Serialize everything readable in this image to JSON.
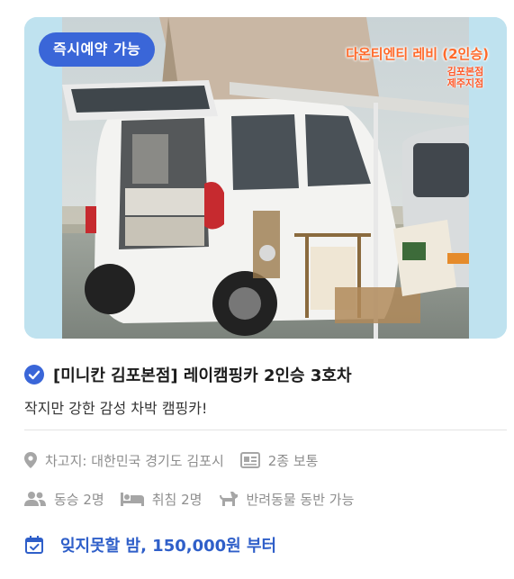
{
  "card": {
    "badge": "즉시예약 가능",
    "image_overlay": {
      "title": "다온티엔티 레비 (2인승)",
      "logo_line1": "김포본점",
      "logo_line2": "제주지점"
    },
    "title": "[미니칸 김포본점] 레이캠핑카 2인승 3호차",
    "subtitle": "작지만 강한 감성 차박 캠핑카!",
    "details": {
      "garage": "차고지: 대한민국 경기도 김포시",
      "license": "2종 보통",
      "passengers": "동승 2명",
      "sleeping": "취침 2명",
      "pets": "반려동물 동반 가능"
    },
    "price": "잊지못할 밤, 150,000원 부터"
  },
  "icons": {
    "verified": "check-circle-icon",
    "location": "location-pin-icon",
    "license": "id-card-icon",
    "passengers": "people-icon",
    "sleeping": "bed-icon",
    "pets": "dog-icon",
    "price": "calendar-check-icon"
  },
  "colors": {
    "accent": "#2f5fc9",
    "badge_bg": "#3a66d8",
    "overlay_text": "#ff6a2b",
    "muted": "#8e8e8e"
  }
}
